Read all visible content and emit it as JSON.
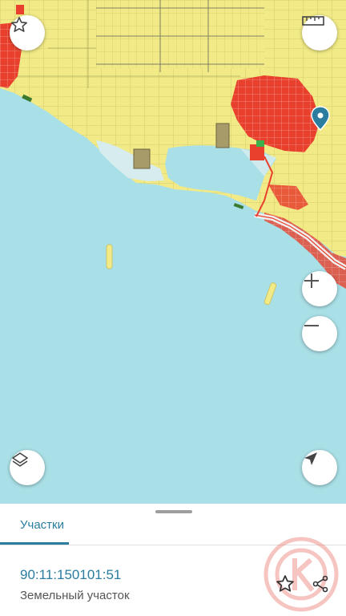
{
  "map": {
    "marker_icon": "location-pin-icon",
    "colors": {
      "water": "#a9dfe6",
      "land_plots": "#f1ea86",
      "urban": "#e8402c",
      "beach": "#d7ecef"
    }
  },
  "controls": {
    "favorite": "star-outline-icon",
    "ruler": "ruler-icon",
    "zoom_in": "plus-icon",
    "zoom_out": "minus-icon",
    "layers": "layers-icon",
    "locate": "navigation-arrow-icon"
  },
  "panel": {
    "tab_label": "Участки",
    "cadastral_number": "90:11:150101:51",
    "property_type": "Земельный участок",
    "accent_color": "#2a7d9e"
  }
}
